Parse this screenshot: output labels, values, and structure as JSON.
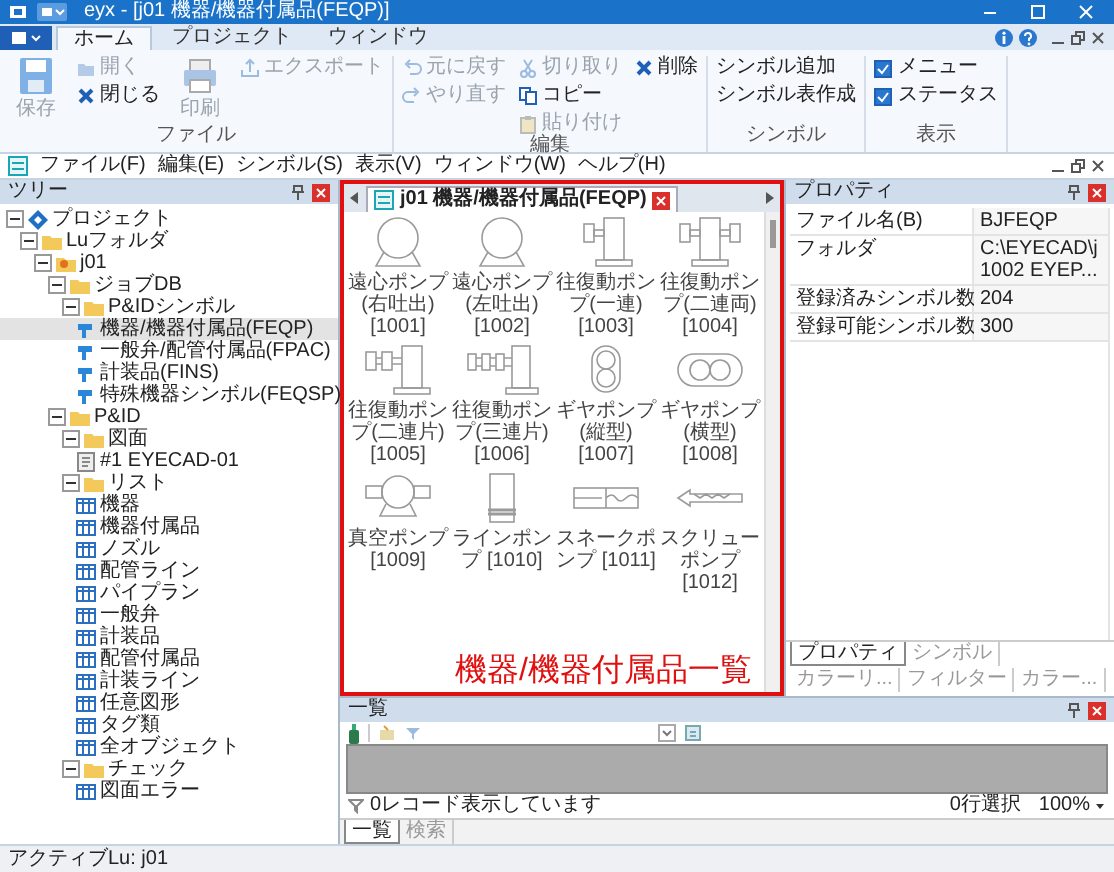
{
  "window": {
    "title": "eyx - [j01 機器/機器付属品(FEQP)]"
  },
  "ribbon": {
    "tabs": [
      {
        "label": "ホーム",
        "selected": true
      },
      {
        "label": "プロジェクト",
        "selected": false
      },
      {
        "label": "ウィンドウ",
        "selected": false
      }
    ],
    "groups": [
      {
        "label": "ファイル",
        "columns": [
          [
            {
              "kind": "large",
              "label": "保存",
              "disabled": true
            }
          ],
          [
            {
              "kind": "small",
              "label": "開く",
              "disabled": true
            },
            {
              "kind": "small",
              "label": "閉じる",
              "disabled": false
            }
          ],
          [
            {
              "kind": "large",
              "label": "印刷",
              "disabled": true
            }
          ],
          [
            {
              "kind": "small",
              "label": "エクスポート",
              "disabled": true
            }
          ]
        ]
      },
      {
        "label": "編集",
        "columns": [
          [
            {
              "kind": "small",
              "label": "元に戻す",
              "disabled": true
            },
            {
              "kind": "small",
              "label": "やり直す",
              "disabled": true
            }
          ],
          [
            {
              "kind": "small",
              "label": "切り取り",
              "disabled": true
            },
            {
              "kind": "small",
              "label": "コピー",
              "disabled": false
            },
            {
              "kind": "small",
              "label": "貼り付け",
              "disabled": true
            }
          ],
          [
            {
              "kind": "small",
              "label": "削除",
              "disabled": false
            }
          ]
        ]
      },
      {
        "label": "シンボル",
        "columns": [
          [
            {
              "kind": "small",
              "label": "シンボル追加",
              "disabled": false
            },
            {
              "kind": "small",
              "label": "シンボル表作成",
              "disabled": false
            }
          ]
        ]
      },
      {
        "label": "表示",
        "columns": [
          [
            {
              "kind": "check",
              "label": "メニュー",
              "checked": true
            },
            {
              "kind": "check",
              "label": "ステータス",
              "checked": true
            }
          ]
        ]
      }
    ]
  },
  "menu": [
    "ファイル(F)",
    "編集(E)",
    "シンボル(S)",
    "表示(V)",
    "ウィンドウ(W)",
    "ヘルプ(H)"
  ],
  "tree": {
    "title": "ツリー",
    "items": [
      {
        "label": "プロジェクト",
        "kind": "project",
        "selected": false,
        "expanded": true,
        "children": [
          {
            "label": "Luフォルダ",
            "kind": "folder",
            "selected": false,
            "expanded": true,
            "children": [
              {
                "label": "j01",
                "kind": "job",
                "selected": false,
                "expanded": true,
                "children": [
                  {
                    "label": "ジョブDB",
                    "kind": "folder",
                    "selected": false,
                    "expanded": true,
                    "children": [
                      {
                        "label": "P&IDシンボル",
                        "kind": "folder",
                        "selected": false,
                        "expanded": true,
                        "children": [
                          {
                            "label": "機器/機器付属品(FEQP)",
                            "kind": "symbol",
                            "selected": true
                          },
                          {
                            "label": "一般弁/配管付属品(FPAC)",
                            "kind": "symbol",
                            "selected": false
                          },
                          {
                            "label": "計装品(FINS)",
                            "kind": "symbol",
                            "selected": false
                          },
                          {
                            "label": "特殊機器シンボル(FEQSP)",
                            "kind": "symbol",
                            "selected": false
                          }
                        ]
                      }
                    ]
                  },
                  {
                    "label": "P&ID",
                    "kind": "folder",
                    "selected": false,
                    "expanded": true,
                    "children": [
                      {
                        "label": "図面",
                        "kind": "folder",
                        "selected": false,
                        "expanded": true,
                        "children": [
                          {
                            "label": "#1 EYECAD-01",
                            "kind": "drawing",
                            "selected": false
                          }
                        ]
                      },
                      {
                        "label": "リスト",
                        "kind": "folder",
                        "selected": false,
                        "expanded": true,
                        "children": [
                          {
                            "label": "機器",
                            "kind": "list",
                            "selected": false
                          },
                          {
                            "label": "機器付属品",
                            "kind": "list",
                            "selected": false
                          },
                          {
                            "label": "ノズル",
                            "kind": "list",
                            "selected": false
                          },
                          {
                            "label": "配管ライン",
                            "kind": "list",
                            "selected": false
                          },
                          {
                            "label": "パイプラン",
                            "kind": "list",
                            "selected": false
                          },
                          {
                            "label": "一般弁",
                            "kind": "list",
                            "selected": false
                          },
                          {
                            "label": "計装品",
                            "kind": "list",
                            "selected": false
                          },
                          {
                            "label": "配管付属品",
                            "kind": "list",
                            "selected": false
                          },
                          {
                            "label": "計装ライン",
                            "kind": "list",
                            "selected": false
                          },
                          {
                            "label": "任意図形",
                            "kind": "list",
                            "selected": false
                          },
                          {
                            "label": "タグ類",
                            "kind": "list",
                            "selected": false
                          },
                          {
                            "label": "全オブジェクト",
                            "kind": "list",
                            "selected": false
                          }
                        ]
                      },
                      {
                        "label": "チェック",
                        "kind": "folder",
                        "selected": false,
                        "expanded": true,
                        "children": [
                          {
                            "label": "図面エラー",
                            "kind": "list",
                            "selected": false
                          }
                        ]
                      }
                    ]
                  }
                ]
              }
            ]
          }
        ]
      }
    ]
  },
  "document_tab": {
    "label": "j01 機器/機器付属品(FEQP)"
  },
  "symbols": [
    {
      "caption": "遠心ポンプ(右吐出) [1001]",
      "kind": "centrifugal"
    },
    {
      "caption": "遠心ポンプ(左吐出) [1002]",
      "kind": "centrifugal"
    },
    {
      "caption": "往復動ポンプ(一連) [1003]",
      "kind": "simplex"
    },
    {
      "caption": "往復動ポンプ(二連両) [1004]",
      "kind": "duplex"
    },
    {
      "caption": "往復動ポンプ(二連片) [1005]",
      "kind": "duplexsingle"
    },
    {
      "caption": "往復動ポンプ(三連片) [1006]",
      "kind": "triplex"
    },
    {
      "caption": "ギヤポンプ(縦型) [1007]",
      "kind": "gearv"
    },
    {
      "caption": "ギヤポンプ(横型) [1008]",
      "kind": "gearh"
    },
    {
      "caption": "真空ポンプ [1009]",
      "kind": "vacuum"
    },
    {
      "caption": "ラインポンプ [1010]",
      "kind": "inline"
    },
    {
      "caption": "スネークポンプ [1011]",
      "kind": "snake"
    },
    {
      "caption": "スクリューポンプ [1012]",
      "kind": "screw"
    }
  ],
  "annotation": {
    "text": "機器/機器付属品一覧"
  },
  "properties": {
    "title": "プロパティ",
    "rows": [
      {
        "name": "ファイル名(B)",
        "value": "BJFEQP"
      },
      {
        "name": "フォルダ",
        "value": "C:\\EYECAD\\j1002 EYEP..."
      },
      {
        "name": "登録済みシンボル数",
        "value": "204"
      },
      {
        "name": "登録可能シンボル数",
        "value": "300"
      }
    ],
    "tabs": [
      {
        "label": "プロパティ",
        "selected": true
      },
      {
        "label": "シンボル",
        "selected": false
      },
      {
        "label": "カラーリ...",
        "selected": false
      },
      {
        "label": "フィルター",
        "selected": false
      },
      {
        "label": "カラー...",
        "selected": false
      }
    ]
  },
  "list_panel": {
    "title": "一覧",
    "record_status": "0レコード表示しています",
    "selection": "0行選択",
    "zoom": "100%",
    "tabs": [
      {
        "label": "一覧",
        "selected": true
      },
      {
        "label": "検索",
        "selected": false
      }
    ]
  },
  "status_bar": {
    "text": "アクティブLu: j01"
  }
}
